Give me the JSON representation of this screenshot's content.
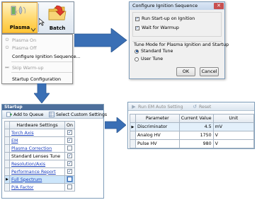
{
  "ribbon": {
    "plasma_label": "Plasma",
    "batch_label": "Batch"
  },
  "plasma_menu": {
    "items": [
      {
        "label": "Plasma On",
        "enabled": false,
        "icon": "power-on-icon"
      },
      {
        "label": "Plasma Off",
        "enabled": false,
        "icon": "power-off-icon"
      },
      {
        "label": "Configure Ignition Sequence...",
        "enabled": true,
        "icon": ""
      },
      {
        "label": "Skip Warm-up",
        "enabled": false,
        "icon": "skip-icon"
      },
      {
        "label": "Startup Configuration",
        "enabled": true,
        "icon": ""
      }
    ]
  },
  "ignition_dialog": {
    "title": "Configure Ignition Sequence",
    "run_startup_label": "Run Start-up on Ignition",
    "run_startup_checked": true,
    "wait_warmup_label": "Wait for Warmup",
    "wait_warmup_checked": true,
    "tune_mode_label": "Tune Mode for Plasma Ignition and Startup",
    "standard_tune_label": "Standard Tune",
    "user_tune_label": "User Tune",
    "selected_tune": "Standard Tune",
    "ok_label": "OK",
    "cancel_label": "Cancel"
  },
  "startup_panel": {
    "title": "Startup",
    "add_to_queue_label": "Add to Queue",
    "select_custom_label": "Select Custom Settings",
    "col_settings": "Hardware Settings",
    "col_on": "On",
    "rows": [
      {
        "label": "Torch Axis",
        "link": true,
        "on": true
      },
      {
        "label": "EM",
        "link": true,
        "on": true
      },
      {
        "label": "Plasma Correction",
        "link": true,
        "on": false
      },
      {
        "label": "Standard Lenses Tune",
        "link": false,
        "on": true
      },
      {
        "label": "Resolution/Axis",
        "link": true,
        "on": true
      },
      {
        "label": "Performance Report",
        "link": true,
        "on": true
      },
      {
        "label": "Full Spectrum",
        "link": true,
        "on": false
      },
      {
        "label": "P/A Factor",
        "link": true,
        "on": false
      }
    ]
  },
  "em_panel": {
    "run_label": "Run EM Auto Setting",
    "reset_label": "Reset",
    "columns": [
      "Parameter",
      "Current Value",
      "Unit"
    ],
    "rows": [
      {
        "parameter": "Discriminator",
        "value": "4.5",
        "unit": "mV"
      },
      {
        "parameter": "Analog HV",
        "value": "1750",
        "unit": "V"
      },
      {
        "parameter": "Pulse HV",
        "value": "980",
        "unit": "V"
      }
    ]
  },
  "colors": {
    "arrow": "#3a6fb5",
    "link": "#1a3fbf",
    "selection": "#cde6fb"
  }
}
